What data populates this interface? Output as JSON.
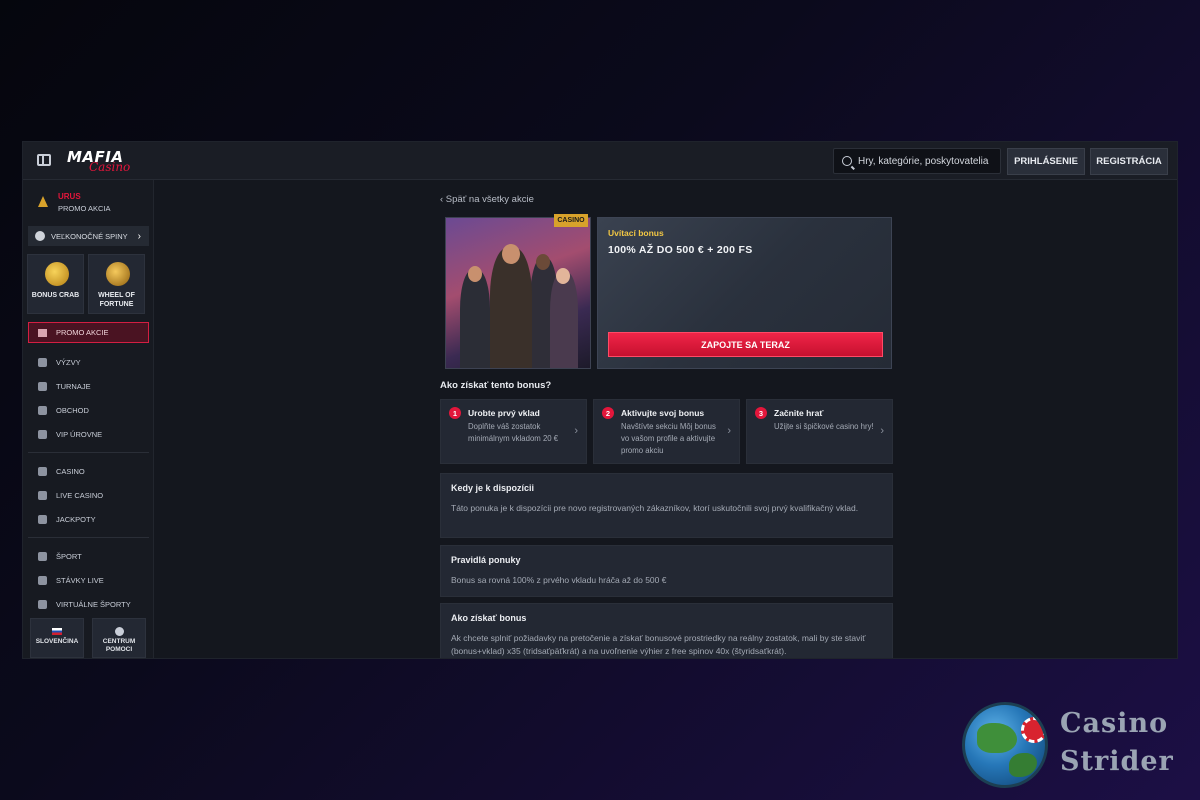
{
  "header": {
    "logo_main": "MAFIA",
    "logo_sub": "Casino",
    "search_placeholder": "Hry, kategórie, poskytovatelia",
    "login_label": "PRIHLÁSENIE",
    "register_label": "REGISTRÁCIA"
  },
  "sidebar": {
    "urus_title": "URUS",
    "urus_sub": "PROMO AKCIA",
    "spins_label": "VEĽKONOČNÉ SPINY",
    "tiles": [
      {
        "label_1": "BONUS CRAB",
        "label_2": ""
      },
      {
        "label_1": "WHEEL OF",
        "label_2": "FORTUNE"
      }
    ],
    "promo_label": "PROMO AKCIE",
    "menu": [
      "VÝZVY",
      "TURNAJE",
      "OBCHOD",
      "VIP ÚROVNE",
      "CASINO",
      "LIVE CASINO",
      "JACKPOTY",
      "ŠPORT",
      "STÁVKY LIVE",
      "VIRTUÁLNE ŠPORTY"
    ],
    "language_label": "SLOVENČINA",
    "help_label_1": "CENTRUM",
    "help_label_2": "POMOCI"
  },
  "main": {
    "back_link": "‹ Späť na všetky akcie",
    "badge": "CASINO",
    "bonus_tag": "Uvítací bonus",
    "bonus_title": "100% AŽ DO 500 € + 200 FS",
    "cta_label": "ZAPOJTE SA TERAZ",
    "howto_title": "Ako získať tento bonus?",
    "steps": [
      {
        "num": "1",
        "title": "Urobte prvý vklad",
        "desc": "Doplňte váš zostatok minimálnym vkladom 20 €"
      },
      {
        "num": "2",
        "title": "Aktivujte svoj bonus",
        "desc": "Navštívte sekciu Môj bonus vo vašom profile a aktivujte promo akciu"
      },
      {
        "num": "3",
        "title": "Začnite hrať",
        "desc": "Užijte si špičkové casino hry!"
      }
    ],
    "info": [
      {
        "title": "Kedy je k dispozícii",
        "body": "Táto ponuka je k dispozícii pre novo registrovaných zákazníkov, ktorí uskutočnili svoj prvý kvalifikačný vklad."
      },
      {
        "title": "Pravidlá ponuky",
        "body": "Bonus sa rovná 100% z prvého vkladu hráča až do 500 €"
      },
      {
        "title": "Ako získať bonus",
        "body": "Ak chcete splniť požiadavky na pretočenie a získať bonusové prostriedky na reálny zostatok, mali by ste staviť (bonus+vklad) x35 (tridsaťpäťkrát) a na uvoľnenie výhier z free spinov 40x (štyridsaťkrát)."
      }
    ]
  },
  "watermark": {
    "line1": "Casino",
    "line2": "Strider"
  },
  "colors": {
    "accent": "#e3163b",
    "gold": "#f2c744",
    "bg": "#14171e"
  }
}
